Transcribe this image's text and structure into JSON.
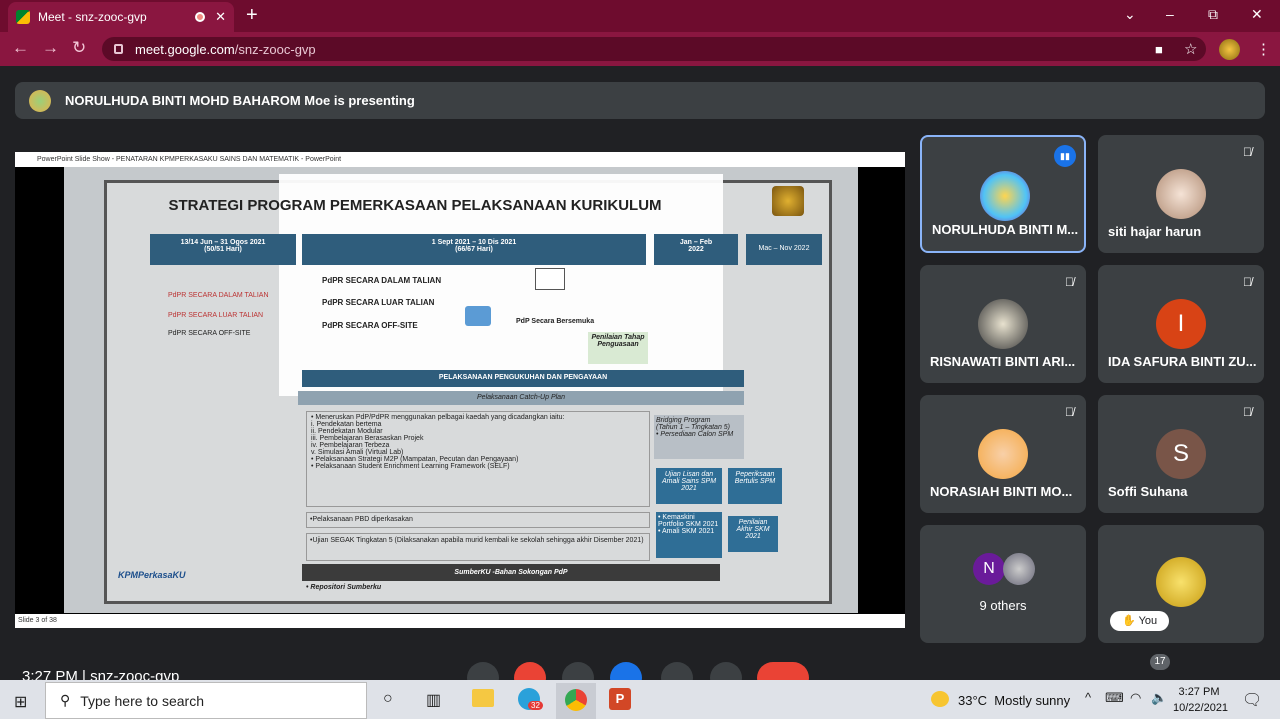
{
  "browser": {
    "tab_title": "Meet - snz-zooc-gvp",
    "new_tab": "+",
    "url_host": "meet.google.com",
    "url_path": "/snz-zooc-gvp",
    "window_min": "–",
    "window_max": "⧉",
    "window_close": "✕"
  },
  "meet": {
    "presenting_text": "NORULHUDA BINTI MOHD BAHAROM Moe is presenting",
    "bottom_time": "3:27 PM",
    "bottom_code": "snz-zooc-gvp",
    "participant_count": "17",
    "tiles": [
      {
        "name": "NORULHUDA BINTI M...",
        "initial": "",
        "color": "#8fd3e8",
        "speaking": true
      },
      {
        "name": "siti hajar harun",
        "initial": "",
        "color": "#f0d8c8",
        "muted": true
      },
      {
        "name": "RISNAWATI BINTI ARI...",
        "initial": "",
        "color": "#d9d2c0",
        "muted": true
      },
      {
        "name": "IDA SAFURA BINTI ZU...",
        "initial": "I",
        "color": "#d84315",
        "muted": true
      },
      {
        "name": "NORASIAH BINTI MO...",
        "initial": "",
        "color": "#f4a742",
        "muted": true
      },
      {
        "name": "Soffi Suhana",
        "initial": "S",
        "color": "#795548",
        "muted": true
      },
      {
        "name": "9 others",
        "initial": "N",
        "color": "#6a1b9a"
      },
      {
        "name": "",
        "initial": "",
        "color": "#f3c530",
        "you_label": "You"
      }
    ]
  },
  "slide": {
    "ppt_bar": "PowerPoint Slide Show - PENATARAN KPMPERKASAKU SAINS DAN MATEMATIK - PowerPoint",
    "title": "STRATEGI PROGRAM PEMERKASAAN PELAKSANAAN KURIKULUM",
    "col1_head": "13/14 Jun – 31 Ogos 2021\n(50/51 Hari)",
    "col2_head": "1 Sept 2021 – 10 Dis 2021\n(66/67 Hari)",
    "col3_head": "Jan – Feb\n2022",
    "col4_head": "Mac – Nov 2022",
    "left_items": [
      "PdPR SECARA DALAM TALIAN",
      "PdPR SECARA LUAR TALIAN",
      "PdPR SECARA OFF-SITE"
    ],
    "mid_items": [
      "PdPR SECARA DALAM TALIAN",
      "PdPR SECARA LUAR TALIAN",
      "PdPR SECARA OFF-SITE"
    ],
    "pdp_label": "PdP Secara Bersemuka",
    "penilaian": "Penilaian Tahap Penguasaan",
    "band1": "PELAKSANAAN PENGUKUHAN DAN PENGAYAAN",
    "band2": "Pelaksanaan Catch-Up Plan",
    "list": [
      "• Meneruskan PdP/PdPR menggunakan pelbagai kaedah yang dicadangkan iaitu:",
      "i.   Pendekatan bertema",
      "ii.  Pendekatan Modular",
      "iii. Pembelajaran Berasaskan Projek",
      "iv.  Pembelajaran Terbeza",
      "v.   Simulasi Amali (Virtual Lab)",
      "• Pelaksanaan Strategi M2P (Mampatan, Pecutan dan Pengayaan)",
      "• Pelaksanaan Student Enrichment Learning Framework (SELF)"
    ],
    "pbd": "•Pelaksanaan PBD diperkasakan",
    "segak": "•Ujian SEGAK Tingkatan 5 (Dilaksanakan apabila murid kembali ke sekolah sehingga akhir Disember 2021)",
    "sumber": "SumberKU -Bahan Sokongan PdP",
    "repo": "• Repositori Sumberku",
    "bridging": "Bridging Program\n(Tahun 1 – Tingkatan 5)\n• Persediaan Calon SPM",
    "ujian": "Ujian Lisan dan Amali Sains SPM 2021",
    "peperiksaan": "Peperiksaan Bertulis SPM",
    "kemaskini": "• Kemaskini Portfolio SKM 2021\n• Amali SKM 2021",
    "penilaian_skm": "Penilaian Akhir SKM 2021",
    "logo": "KPMPerkasaKU",
    "status": "Slide 3 of 38"
  },
  "taskbar": {
    "search_placeholder": "Type here to search",
    "weather": "33°C  Mostly sunny",
    "time": "3:27 PM",
    "date": "10/22/2021",
    "notif": "1",
    "badge": "32"
  }
}
